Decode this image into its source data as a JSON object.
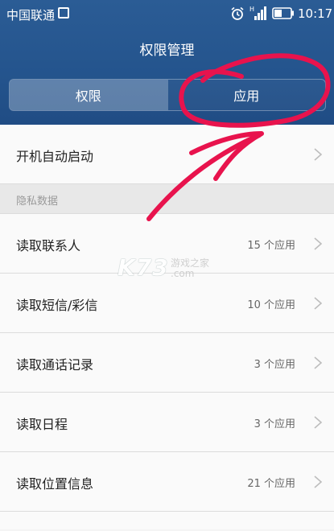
{
  "statusbar": {
    "carrier": "中国联通",
    "time": "10:17",
    "icons": [
      "image-icon",
      "alarm-icon",
      "signal-icon",
      "battery-icon"
    ]
  },
  "header": {
    "title": "权限管理",
    "tabs": [
      {
        "label": "权限",
        "active": true
      },
      {
        "label": "应用",
        "active": false
      }
    ]
  },
  "list": {
    "autostart": {
      "label": "开机自动启动"
    },
    "section_title": "隐私数据",
    "items": [
      {
        "label": "读取联系人",
        "count": "15 个应用"
      },
      {
        "label": "读取短信/彩信",
        "count": "10 个应用"
      },
      {
        "label": "读取通话记录",
        "count": "3 个应用"
      },
      {
        "label": "读取日程",
        "count": "3 个应用"
      },
      {
        "label": "读取位置信息",
        "count": "21 个应用"
      }
    ]
  },
  "watermark": {
    "brand": "K73",
    "sub": "游戏之家",
    "domain": ".com"
  },
  "colors": {
    "header": "#24548d",
    "annotation": "#e8134d"
  }
}
